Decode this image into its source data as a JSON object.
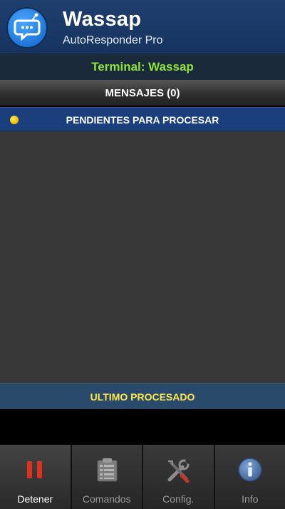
{
  "header": {
    "title": "Wassap",
    "subtitle": "AutoResponder Pro",
    "icon": "chat-bubble-icon"
  },
  "terminal": {
    "label": "Terminal: Wassap"
  },
  "messages": {
    "label": "MENSAJES (0)"
  },
  "pending": {
    "label": "PENDIENTES PARA PROCESAR",
    "status_color": "#f2c500"
  },
  "last_processed": {
    "label": "ULTIMO PROCESADO"
  },
  "nav": [
    {
      "label": "Detener",
      "icon": "pause-icon",
      "active": true
    },
    {
      "label": "Comandos",
      "icon": "clipboard-icon",
      "active": false
    },
    {
      "label": "Config.",
      "icon": "tools-icon",
      "active": false
    },
    {
      "label": "Info",
      "icon": "info-icon",
      "active": false
    }
  ],
  "colors": {
    "header_bg": "#173460",
    "terminal_text": "#8ee43a",
    "last_processed_text": "#ffe84a",
    "pause_red": "#e0301e"
  }
}
